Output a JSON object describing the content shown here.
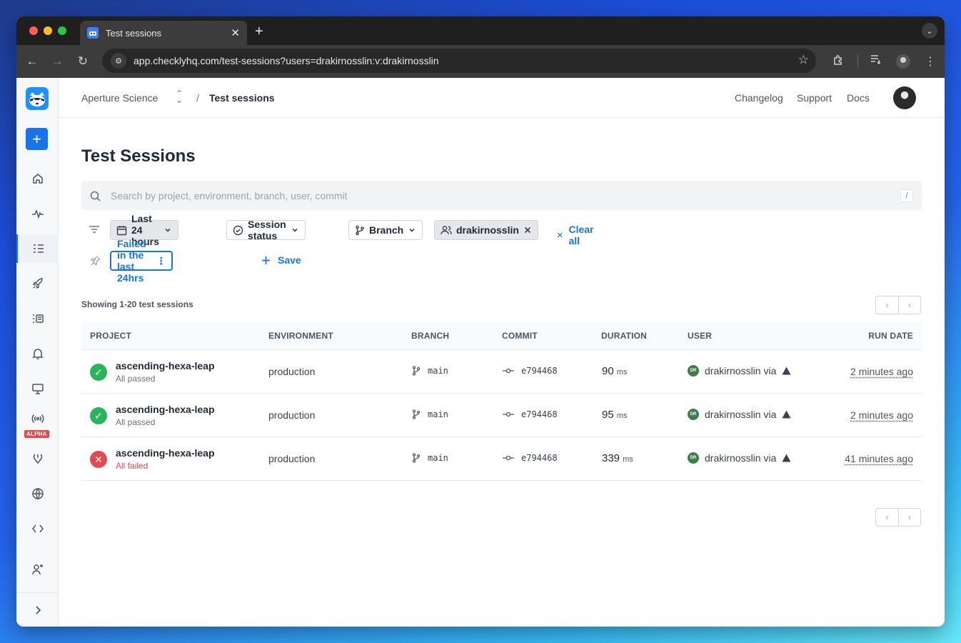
{
  "browser": {
    "tab_title": "Test sessions",
    "url": "app.checklyhq.com/test-sessions?users=drakirnosslin:v:drakirnosslin"
  },
  "topbar": {
    "org": "Aperture Science",
    "separator": "/",
    "page": "Test sessions",
    "links": [
      "Changelog",
      "Support",
      "Docs"
    ]
  },
  "sidebar": {
    "alpha_label": "ALPHA"
  },
  "main": {
    "title": "Test Sessions",
    "search_placeholder": "Search by project, environment, branch, user, commit",
    "search_shortcut": "/",
    "filters": {
      "time": "Last 24 hours",
      "status": "Session status",
      "branch": "Branch",
      "user": "drakirnosslin",
      "clear_all": "Clear all"
    },
    "saved_view": "Failed in the last 24hrs",
    "save_label": "Save",
    "showing": "Showing 1-20 test sessions",
    "columns": [
      "PROJECT",
      "ENVIRONMENT",
      "BRANCH",
      "COMMIT",
      "DURATION",
      "USER",
      "RUN DATE"
    ],
    "rows": [
      {
        "project": "ascending-hexa-leap",
        "status": "All passed",
        "state": "pass",
        "environment": "production",
        "branch": "main",
        "commit": "e794468",
        "duration": "90",
        "duration_unit": "ms",
        "user": "drakirnosslin via",
        "user_initials": "DR",
        "run_date": "2 minutes ago"
      },
      {
        "project": "ascending-hexa-leap",
        "status": "All passed",
        "state": "pass",
        "environment": "production",
        "branch": "main",
        "commit": "e794468",
        "duration": "95",
        "duration_unit": "ms",
        "user": "drakirnosslin via",
        "user_initials": "DR",
        "run_date": "2 minutes ago"
      },
      {
        "project": "ascending-hexa-leap",
        "status": "All failed",
        "state": "fail",
        "environment": "production",
        "branch": "main",
        "commit": "e794468",
        "duration": "339",
        "duration_unit": "ms",
        "user": "drakirnosslin via",
        "user_initials": "DR",
        "run_date": "41 minutes ago"
      }
    ]
  },
  "colors": {
    "accent": "#1a73e8",
    "pass": "#2bb55a",
    "fail": "#e5484d"
  }
}
